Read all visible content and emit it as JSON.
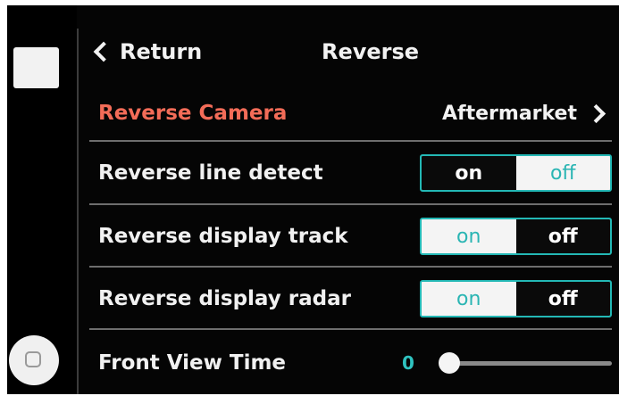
{
  "header": {
    "back_label": "Return",
    "title": "Reverse"
  },
  "settings": {
    "reverse_camera": {
      "label": "Reverse Camera",
      "value": "Aftermarket"
    },
    "reverse_line_detect": {
      "label": "Reverse line detect",
      "on_label": "on",
      "off_label": "off",
      "selected": "on"
    },
    "reverse_display_track": {
      "label": "Reverse display track",
      "on_label": "on",
      "off_label": "off",
      "selected": "off"
    },
    "reverse_display_radar": {
      "label": "Reverse display radar",
      "on_label": "on",
      "off_label": "off",
      "selected": "off"
    },
    "front_view_time": {
      "label": "Front View Time",
      "value": "0"
    }
  },
  "colors": {
    "accent_label": "#f36c58",
    "toggle_border": "#23b8b5",
    "slider_value": "#2fc3c0"
  },
  "icons": {
    "back": "chevron-left-icon",
    "forward": "chevron-right-icon",
    "home": "home-button-icon"
  }
}
